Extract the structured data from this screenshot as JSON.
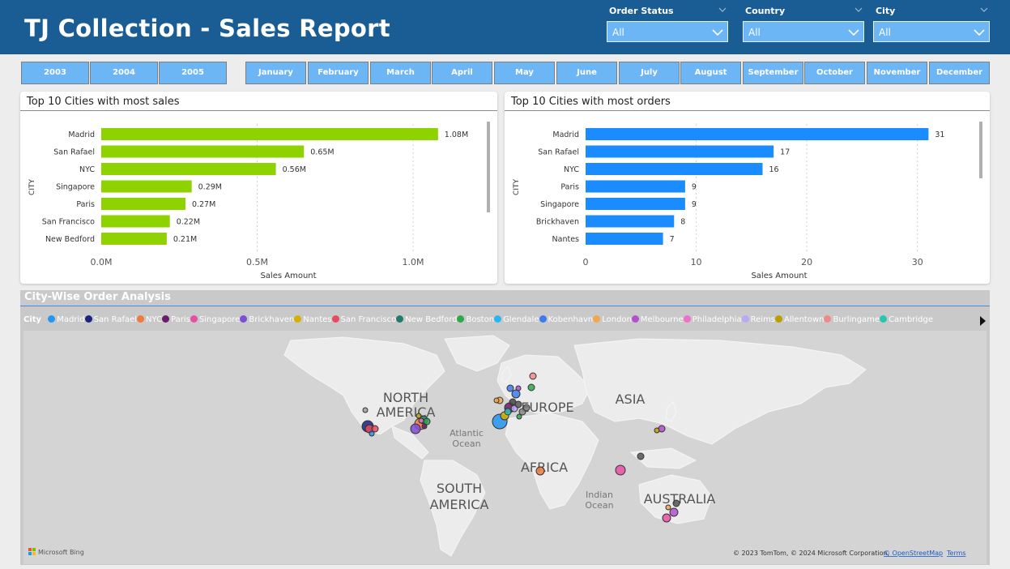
{
  "header": {
    "title": "TJ Collection - Sales Report"
  },
  "filters": [
    {
      "label": "Order Status",
      "value": "All"
    },
    {
      "label": "Country",
      "value": "All"
    },
    {
      "label": "City",
      "value": "All"
    }
  ],
  "years": [
    "2003",
    "2004",
    "2005"
  ],
  "months": [
    "January",
    "February",
    "March",
    "April",
    "May",
    "June",
    "July",
    "August",
    "September",
    "October",
    "November",
    "December"
  ],
  "sales_chart": {
    "title": "Top 10 Cities with most sales",
    "ylabel": "CITY",
    "xlabel": "Sales Amount",
    "xticks": [
      "0.0M",
      "0.5M",
      "1.0M"
    ],
    "bar_color": "#8ed200"
  },
  "orders_chart": {
    "title": "Top 10 Cities with most orders",
    "ylabel": "CITY",
    "xlabel": "Sales Amount",
    "xticks": [
      "0",
      "10",
      "20",
      "30"
    ],
    "bar_color": "#1a8cff"
  },
  "chart_data": [
    {
      "type": "bar",
      "orientation": "horizontal",
      "title": "Top 10 Cities with most sales",
      "ylabel": "CITY",
      "xlabel": "Sales Amount",
      "xlim": [
        0,
        1.2
      ],
      "categories": [
        "Madrid",
        "San Rafael",
        "NYC",
        "Singapore",
        "Paris",
        "San Francisco",
        "New Bedford"
      ],
      "values": [
        1.08,
        0.65,
        0.56,
        0.29,
        0.27,
        0.22,
        0.21
      ],
      "data_labels": [
        "1.08M",
        "0.65M",
        "0.56M",
        "0.29M",
        "0.27M",
        "0.22M",
        "0.21M"
      ],
      "grid": true
    },
    {
      "type": "bar",
      "orientation": "horizontal",
      "title": "Top 10 Cities with most orders",
      "ylabel": "CITY",
      "xlabel": "Sales Amount",
      "xlim": [
        0,
        35
      ],
      "categories": [
        "Madrid",
        "San Rafael",
        "NYC",
        "Paris",
        "Singapore",
        "Brickhaven",
        "Nantes"
      ],
      "values": [
        31,
        17,
        16,
        9,
        9,
        8,
        7
      ],
      "data_labels": [
        "31",
        "17",
        "16",
        "9",
        "9",
        "8",
        "7"
      ],
      "grid": true
    }
  ],
  "map": {
    "title": "City-Wise Order Analysis",
    "legend_title": "City",
    "legend": [
      {
        "name": "Madrid",
        "color": "#2196f3"
      },
      {
        "name": "San Rafael",
        "color": "#1a237e"
      },
      {
        "name": "NYC",
        "color": "#f07a3c"
      },
      {
        "name": "Paris",
        "color": "#6a1b6a"
      },
      {
        "name": "Singapore",
        "color": "#e94ea5"
      },
      {
        "name": "Brickhaven",
        "color": "#7c4dd6"
      },
      {
        "name": "Nantes",
        "color": "#d6b000"
      },
      {
        "name": "San Francisco",
        "color": "#e84a5f"
      },
      {
        "name": "New Bedford",
        "color": "#1f7a70"
      },
      {
        "name": "Boston",
        "color": "#2ea84a"
      },
      {
        "name": "Glendale",
        "color": "#29b6f6"
      },
      {
        "name": "Kobenhavn",
        "color": "#3a7bf0"
      },
      {
        "name": "London",
        "color": "#f4a64a"
      },
      {
        "name": "Melbourne",
        "color": "#b44fd0"
      },
      {
        "name": "Philadelphia",
        "color": "#f06fc9"
      },
      {
        "name": "Reims",
        "color": "#b9a8f4"
      },
      {
        "name": "Allentown",
        "color": "#b8a000"
      },
      {
        "name": "Burlingame",
        "color": "#f08a8a"
      },
      {
        "name": "Cambridge",
        "color": "#25c7b0"
      }
    ],
    "continents": [
      "NORTH AMERICA",
      "EUROPE",
      "ASIA",
      "AFRICA",
      "SOUTH AMERICA",
      "AUSTRALIA"
    ],
    "oceans": [
      "Atlantic Ocean",
      "Indian Ocean"
    ],
    "bing_label": "Microsoft Bing",
    "attribution": "© 2023 TomTom, © 2024 Microsoft Corporation,",
    "osm_link": "© OpenStreetMap",
    "terms_link": "Terms"
  }
}
